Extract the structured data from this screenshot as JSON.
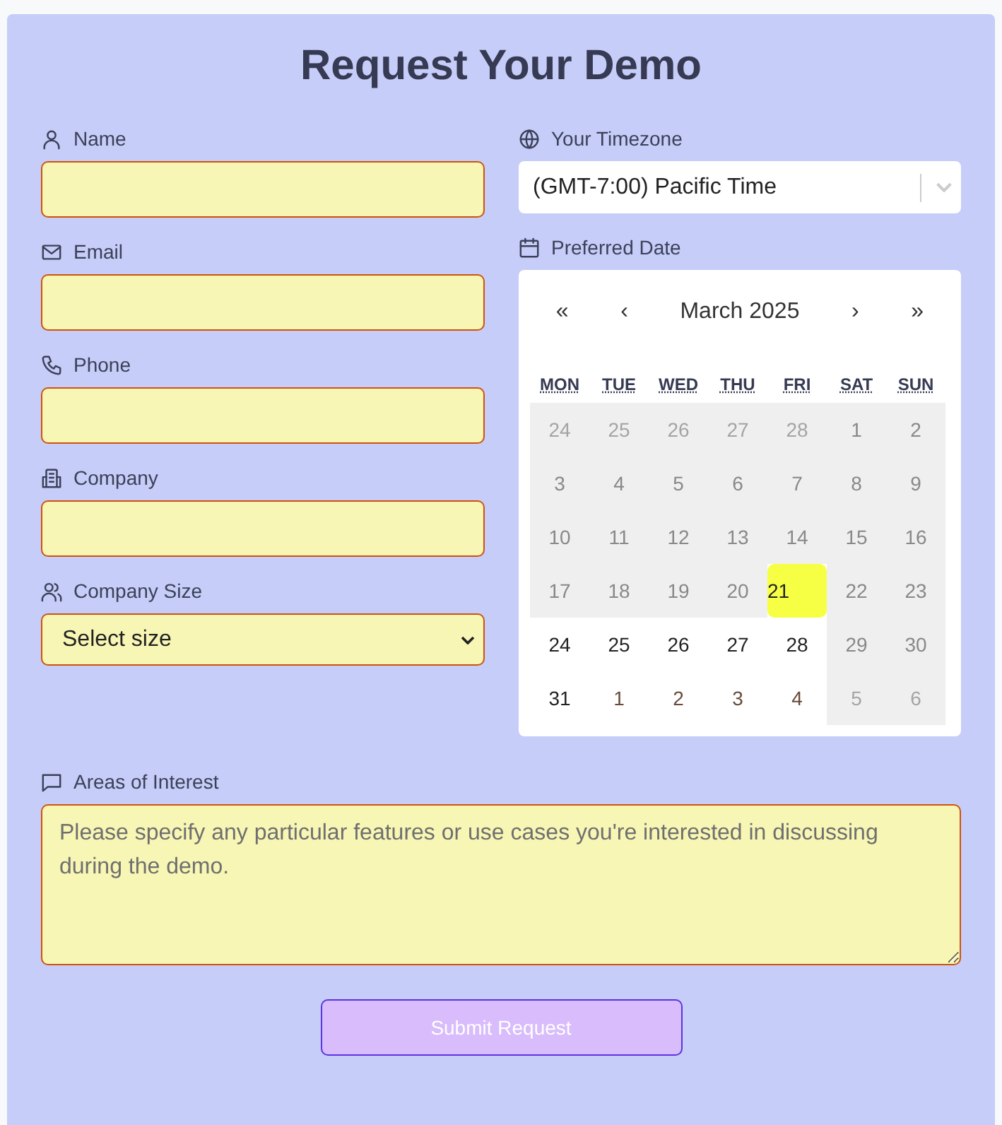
{
  "title": "Request Your Demo",
  "fields": [
    {
      "label": "Name",
      "kind": "text"
    },
    {
      "label": "Email",
      "kind": "text"
    },
    {
      "label": "Phone",
      "kind": "text"
    },
    {
      "label": "Company",
      "kind": "text"
    },
    {
      "label": "Company Size",
      "kind": "select",
      "value": "Select size"
    }
  ],
  "timezone": {
    "label": "Your Timezone",
    "value": "(GMT-7:00) Pacific Time"
  },
  "date": {
    "label": "Preferred Date",
    "nav": [
      "«",
      "‹",
      "›",
      "»"
    ],
    "month": "March 2025",
    "weekdays": [
      "MON",
      "TUE",
      "WED",
      "THU",
      "FRI",
      "SAT",
      "SUN"
    ],
    "weeks": [
      [
        {
          "label": "24",
          "disabled": true,
          "outside": true,
          "selected": false
        },
        {
          "label": "25",
          "disabled": true,
          "outside": true,
          "selected": false
        },
        {
          "label": "26",
          "disabled": true,
          "outside": true,
          "selected": false
        },
        {
          "label": "27",
          "disabled": true,
          "outside": true,
          "selected": false
        },
        {
          "label": "28",
          "disabled": true,
          "outside": true,
          "selected": false
        },
        {
          "label": "1",
          "disabled": true,
          "outside": false,
          "selected": false
        },
        {
          "label": "2",
          "disabled": true,
          "outside": false,
          "selected": false
        }
      ],
      [
        {
          "label": "3",
          "disabled": true,
          "outside": false,
          "selected": false
        },
        {
          "label": "4",
          "disabled": true,
          "outside": false,
          "selected": false
        },
        {
          "label": "5",
          "disabled": true,
          "outside": false,
          "selected": false
        },
        {
          "label": "6",
          "disabled": true,
          "outside": false,
          "selected": false
        },
        {
          "label": "7",
          "disabled": true,
          "outside": false,
          "selected": false
        },
        {
          "label": "8",
          "disabled": true,
          "outside": false,
          "selected": false
        },
        {
          "label": "9",
          "disabled": true,
          "outside": false,
          "selected": false
        }
      ],
      [
        {
          "label": "10",
          "disabled": true,
          "outside": false,
          "selected": false
        },
        {
          "label": "11",
          "disabled": true,
          "outside": false,
          "selected": false
        },
        {
          "label": "12",
          "disabled": true,
          "outside": false,
          "selected": false
        },
        {
          "label": "13",
          "disabled": true,
          "outside": false,
          "selected": false
        },
        {
          "label": "14",
          "disabled": true,
          "outside": false,
          "selected": false
        },
        {
          "label": "15",
          "disabled": true,
          "outside": false,
          "selected": false
        },
        {
          "label": "16",
          "disabled": true,
          "outside": false,
          "selected": false
        }
      ],
      [
        {
          "label": "17",
          "disabled": true,
          "outside": false,
          "selected": false
        },
        {
          "label": "18",
          "disabled": true,
          "outside": false,
          "selected": false
        },
        {
          "label": "19",
          "disabled": true,
          "outside": false,
          "selected": false
        },
        {
          "label": "20",
          "disabled": true,
          "outside": false,
          "selected": false
        },
        {
          "label": "21",
          "disabled": false,
          "outside": false,
          "selected": true
        },
        {
          "label": "22",
          "disabled": true,
          "outside": false,
          "selected": false
        },
        {
          "label": "23",
          "disabled": true,
          "outside": false,
          "selected": false
        }
      ],
      [
        {
          "label": "24",
          "disabled": false,
          "outside": false,
          "selected": false
        },
        {
          "label": "25",
          "disabled": false,
          "outside": false,
          "selected": false
        },
        {
          "label": "26",
          "disabled": false,
          "outside": false,
          "selected": false
        },
        {
          "label": "27",
          "disabled": false,
          "outside": false,
          "selected": false
        },
        {
          "label": "28",
          "disabled": false,
          "outside": false,
          "selected": false
        },
        {
          "label": "29",
          "disabled": true,
          "outside": false,
          "selected": false
        },
        {
          "label": "30",
          "disabled": true,
          "outside": false,
          "selected": false
        }
      ],
      [
        {
          "label": "31",
          "disabled": false,
          "outside": false,
          "selected": false
        },
        {
          "label": "1",
          "disabled": false,
          "outside": true,
          "selected": false
        },
        {
          "label": "2",
          "disabled": false,
          "outside": true,
          "selected": false
        },
        {
          "label": "3",
          "disabled": false,
          "outside": true,
          "selected": false
        },
        {
          "label": "4",
          "disabled": false,
          "outside": true,
          "selected": false
        },
        {
          "label": "5",
          "disabled": true,
          "outside": true,
          "selected": false
        },
        {
          "label": "6",
          "disabled": true,
          "outside": true,
          "selected": false
        }
      ]
    ]
  },
  "interest": {
    "label": "Areas of Interest",
    "placeholder": "Please specify any particular features or use cases you're interested in discussing during the demo."
  },
  "submit": "Submit Request"
}
